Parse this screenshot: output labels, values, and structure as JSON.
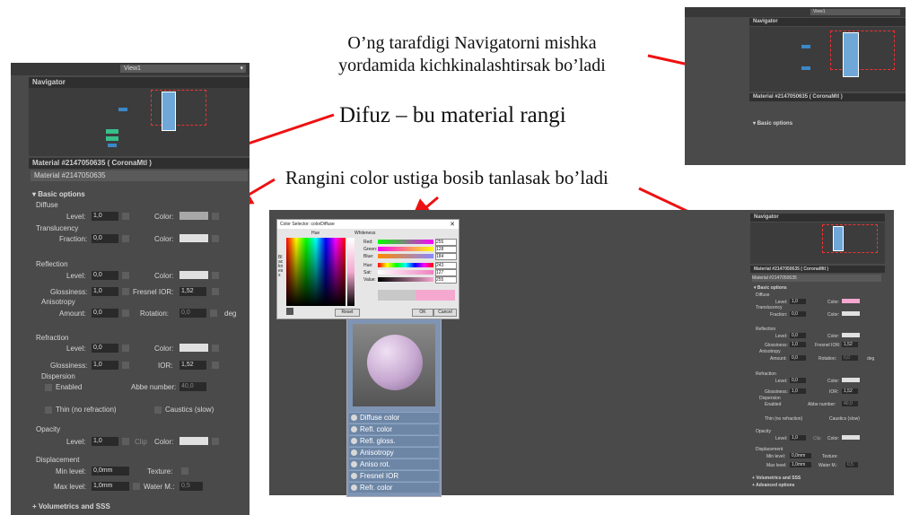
{
  "captions": {
    "navigator_note_line1": "O’ng tarafdigi Navigatorni mishka",
    "navigator_note_line2": "yordamida kichkinalashtirsak bo’ladi",
    "difuz_note": "Difuz – bu material rangi",
    "color_note": "Rangini color ustiga bosib tanlasak bo’ladi"
  },
  "left_panel": {
    "view_dropdown": "View1",
    "navigator_title": "Navigator",
    "material_title": "Material #2147050635  ( CoronaMtl )",
    "material_name": "Material #2147050635",
    "basic_options": "Basic options",
    "diffuse": "Diffuse",
    "level": "Level:",
    "level_val": "1,0",
    "color": "Color:",
    "translucency": "Translucency",
    "fraction": "Fraction:",
    "fraction_val": "0,0",
    "reflection": "Reflection",
    "refl_level_val": "0,0",
    "glossiness": "Glossiness:",
    "gloss_val": "1,0",
    "fresnel": "Fresnel IOR:",
    "fresnel_val": "1,52",
    "anisotropy": "Anisotropy",
    "amount": "Amount:",
    "amount_val": "0,0",
    "rotation": "Rotation:",
    "rotation_val": "0,0",
    "deg": "deg",
    "refraction": "Refraction",
    "refr_level_val": "0,0",
    "refr_gloss_val": "1,0",
    "ior": "IOR:",
    "ior_val": "1,52",
    "dispersion": "Dispersion",
    "enabled": "Enabled",
    "abbe": "Abbe number:",
    "abbe_val": "40,0",
    "thin": "Thin (no refraction)",
    "caustics": "Caustics (slow)",
    "opacity": "Opacity",
    "op_level_val": "1,0",
    "op_clip": "Clip",
    "displacement": "Displacement",
    "min_level": "Min level:",
    "min_level_val": "0,0mm",
    "texture": "Texture:",
    "max_level": "Max level:",
    "max_level_val": "1,0mm",
    "water": "Water M.:",
    "water_val": "0,5",
    "volumetrics": "Volumetrics and SSS"
  },
  "top_right_panel": {
    "view_dropdown": "View1",
    "navigator_title": "Navigator",
    "material_title": "Material #2147050635  ( CoronaMtl )",
    "basic_options": "Basic options"
  },
  "color_selector": {
    "title": "Color Selector: colorDiffuse",
    "hue": "Hue",
    "whiteness": "Whiteness",
    "blackness": "Blackness",
    "red": "Red:",
    "red_val": "255",
    "green": "Green:",
    "green_val": "128",
    "blue": "Blue:",
    "blue_val": "184",
    "hue_lbl": "Hue:",
    "hue_val": "243",
    "sat": "Sat:",
    "sat_val": "127",
    "value": "Value:",
    "value_val": "255",
    "reset": "Reset",
    "ok": "OK",
    "cancel": "Cancel",
    "new_color": "#f4a8d0",
    "old_color": "#c8c8c8"
  },
  "node": {
    "rows": [
      "Diffuse color",
      "Refl. color",
      "Refl. gloss.",
      "Anisotropy",
      "Aniso rot.",
      "Fresnel IOR",
      "Refr. color"
    ]
  },
  "br_panel": {
    "navigator_title": "Navigator",
    "material_title": "Material #2147050635  ( CoronaMtl )",
    "material_name": "Material #2147050635",
    "basic_options": "Basic options",
    "volumetrics": "Volumetrics and SSS",
    "advanced": "Advanced options",
    "diffuse_color": "#f4a8d0"
  }
}
